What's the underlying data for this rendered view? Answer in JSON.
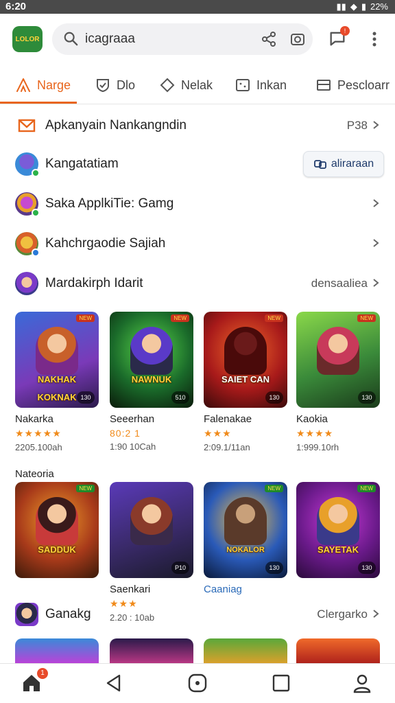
{
  "status_bar": {
    "time": "6:20",
    "battery": "22%"
  },
  "header": {
    "logo_text": "LOLOR",
    "search_text": "icagraaa"
  },
  "tabs": [
    {
      "label": "Narge",
      "icon": "tent-icon",
      "active": true
    },
    {
      "label": "Dlo",
      "icon": "shield-check-icon"
    },
    {
      "label": "Nelak",
      "icon": "diamond-icon"
    },
    {
      "label": "Inkan",
      "icon": "dice-icon"
    },
    {
      "label": "Pescloarr",
      "icon": "panel-icon"
    }
  ],
  "rows": [
    {
      "label": "Apkanyain Nankangndin",
      "right": "P38",
      "icon": "mail-icon"
    },
    {
      "label": "Kangatatiam",
      "button": "aliraraan",
      "icon": "avatar"
    },
    {
      "label": "Saka ApplkiTie: Gamg",
      "icon": "avatar"
    },
    {
      "label": "Kahchrgaodie Sajiah",
      "icon": "avatar"
    },
    {
      "label": "Mardakirph Idarit",
      "right": "densaaliea",
      "icon": "avatar"
    }
  ],
  "games_row1": [
    {
      "name": "Nakarka",
      "stars": "★★★★★",
      "meta": "2205.100ah",
      "banner": "NAKHAK KOKNAK",
      "size": "130",
      "tag": "NEW"
    },
    {
      "name": "Seeerhan",
      "stars": "80:2 1",
      "meta": "1:90 10Cah",
      "banner": "NAWNUK",
      "size": "510",
      "tag": "NEW"
    },
    {
      "name": "Falenakae",
      "stars": "★★★",
      "meta": "2:09.1/11an",
      "banner": "SAIET CAN",
      "size": "130",
      "tag": "NEW"
    },
    {
      "name": "Kaokia",
      "stars": "★★★★",
      "meta": "1:999.10rh",
      "banner": "",
      "size": "130",
      "tag": "NEW"
    }
  ],
  "section2_title": "Nateoria",
  "games_row2": [
    {
      "banner": "SADDUK",
      "size": "",
      "tag": "NEW"
    },
    {
      "name": "Saenkari",
      "stars": "★★★",
      "meta": "2.20 : 10ab",
      "banner": "",
      "size": "P10",
      "tag": ""
    },
    {
      "link": "Caaniag",
      "banner": "NOKALOR",
      "size": "130",
      "tag": "NEW"
    },
    {
      "banner": "SAYETAK",
      "size": "130",
      "tag": "NEW"
    }
  ],
  "row_bottom": {
    "label": "Ganakg",
    "right": "Clergarko"
  },
  "bottom_nav": {
    "home_badge": "1"
  },
  "colors": {
    "accent": "#e8651c",
    "star": "#f08a1a",
    "link": "#2a6ab8"
  }
}
